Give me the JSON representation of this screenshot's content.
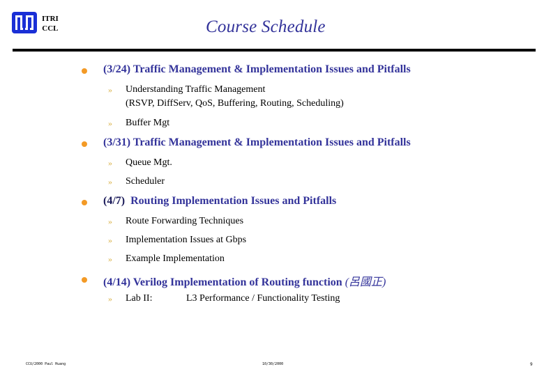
{
  "header": {
    "org_line1": "ITRI",
    "org_line2": "CCL",
    "title": "Course Schedule",
    "logo_color": "#1a2fd6"
  },
  "colors": {
    "title": "#33339a",
    "heading": "#33339a",
    "bullet": "#f39a26",
    "sub_marker": "#d9b146"
  },
  "sections": [
    {
      "date": "(3/24)",
      "title": "Traffic Management & Implementation Issues and Pitfalls",
      "items": [
        {
          "marker": "»",
          "line1": "Understanding Traffic Management",
          "line2": "(RSVP, DiffServ, QoS, Buffering, Routing, Scheduling)"
        },
        {
          "marker": "»",
          "line1": "Buffer Mgt"
        }
      ]
    },
    {
      "date": "(3/31)",
      "title": "Traffic Management & Implementation Issues and Pitfalls",
      "items": [
        {
          "marker": "»",
          "line1": "Queue Mgt."
        },
        {
          "marker": "»",
          "line1": "Scheduler"
        }
      ]
    },
    {
      "date": "(4/7)",
      "title": "Routing Implementation Issues and Pitfalls",
      "items": [
        {
          "marker": "»",
          "line1": "Route Forwarding Techniques"
        },
        {
          "marker": "»",
          "line1": "Implementation Issues at Gbps"
        },
        {
          "marker": "»",
          "line1": "Example Implementation"
        }
      ]
    },
    {
      "date": "(4/14)",
      "title": "Verilog Implementation of Routing function",
      "instructor": "(呂國正)",
      "items": [
        {
          "marker": "»",
          "label": "Lab II:",
          "line1": "L3 Performance / Functionality Testing"
        }
      ]
    }
  ],
  "footer": {
    "left": "CCU/2000 Paul Huang",
    "center": "10/30/2000",
    "page": "9"
  }
}
